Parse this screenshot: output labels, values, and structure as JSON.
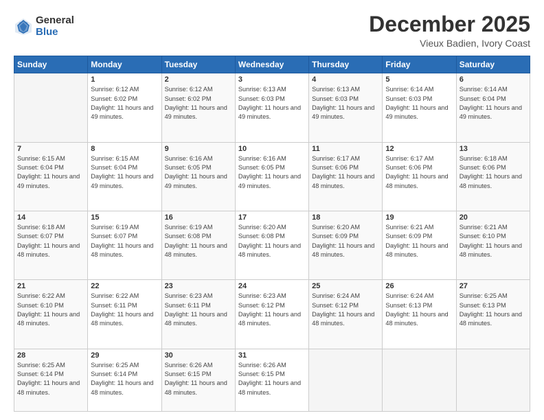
{
  "logo": {
    "general": "General",
    "blue": "Blue"
  },
  "header": {
    "month": "December 2025",
    "location": "Vieux Badien, Ivory Coast"
  },
  "weekdays": [
    "Sunday",
    "Monday",
    "Tuesday",
    "Wednesday",
    "Thursday",
    "Friday",
    "Saturday"
  ],
  "weeks": [
    [
      {
        "day": "",
        "sunrise": "",
        "sunset": "",
        "daylight": ""
      },
      {
        "day": "1",
        "sunrise": "Sunrise: 6:12 AM",
        "sunset": "Sunset: 6:02 PM",
        "daylight": "Daylight: 11 hours and 49 minutes."
      },
      {
        "day": "2",
        "sunrise": "Sunrise: 6:12 AM",
        "sunset": "Sunset: 6:02 PM",
        "daylight": "Daylight: 11 hours and 49 minutes."
      },
      {
        "day": "3",
        "sunrise": "Sunrise: 6:13 AM",
        "sunset": "Sunset: 6:03 PM",
        "daylight": "Daylight: 11 hours and 49 minutes."
      },
      {
        "day": "4",
        "sunrise": "Sunrise: 6:13 AM",
        "sunset": "Sunset: 6:03 PM",
        "daylight": "Daylight: 11 hours and 49 minutes."
      },
      {
        "day": "5",
        "sunrise": "Sunrise: 6:14 AM",
        "sunset": "Sunset: 6:03 PM",
        "daylight": "Daylight: 11 hours and 49 minutes."
      },
      {
        "day": "6",
        "sunrise": "Sunrise: 6:14 AM",
        "sunset": "Sunset: 6:04 PM",
        "daylight": "Daylight: 11 hours and 49 minutes."
      }
    ],
    [
      {
        "day": "7",
        "sunrise": "Sunrise: 6:15 AM",
        "sunset": "Sunset: 6:04 PM",
        "daylight": "Daylight: 11 hours and 49 minutes."
      },
      {
        "day": "8",
        "sunrise": "Sunrise: 6:15 AM",
        "sunset": "Sunset: 6:04 PM",
        "daylight": "Daylight: 11 hours and 49 minutes."
      },
      {
        "day": "9",
        "sunrise": "Sunrise: 6:16 AM",
        "sunset": "Sunset: 6:05 PM",
        "daylight": "Daylight: 11 hours and 49 minutes."
      },
      {
        "day": "10",
        "sunrise": "Sunrise: 6:16 AM",
        "sunset": "Sunset: 6:05 PM",
        "daylight": "Daylight: 11 hours and 49 minutes."
      },
      {
        "day": "11",
        "sunrise": "Sunrise: 6:17 AM",
        "sunset": "Sunset: 6:06 PM",
        "daylight": "Daylight: 11 hours and 48 minutes."
      },
      {
        "day": "12",
        "sunrise": "Sunrise: 6:17 AM",
        "sunset": "Sunset: 6:06 PM",
        "daylight": "Daylight: 11 hours and 48 minutes."
      },
      {
        "day": "13",
        "sunrise": "Sunrise: 6:18 AM",
        "sunset": "Sunset: 6:06 PM",
        "daylight": "Daylight: 11 hours and 48 minutes."
      }
    ],
    [
      {
        "day": "14",
        "sunrise": "Sunrise: 6:18 AM",
        "sunset": "Sunset: 6:07 PM",
        "daylight": "Daylight: 11 hours and 48 minutes."
      },
      {
        "day": "15",
        "sunrise": "Sunrise: 6:19 AM",
        "sunset": "Sunset: 6:07 PM",
        "daylight": "Daylight: 11 hours and 48 minutes."
      },
      {
        "day": "16",
        "sunrise": "Sunrise: 6:19 AM",
        "sunset": "Sunset: 6:08 PM",
        "daylight": "Daylight: 11 hours and 48 minutes."
      },
      {
        "day": "17",
        "sunrise": "Sunrise: 6:20 AM",
        "sunset": "Sunset: 6:08 PM",
        "daylight": "Daylight: 11 hours and 48 minutes."
      },
      {
        "day": "18",
        "sunrise": "Sunrise: 6:20 AM",
        "sunset": "Sunset: 6:09 PM",
        "daylight": "Daylight: 11 hours and 48 minutes."
      },
      {
        "day": "19",
        "sunrise": "Sunrise: 6:21 AM",
        "sunset": "Sunset: 6:09 PM",
        "daylight": "Daylight: 11 hours and 48 minutes."
      },
      {
        "day": "20",
        "sunrise": "Sunrise: 6:21 AM",
        "sunset": "Sunset: 6:10 PM",
        "daylight": "Daylight: 11 hours and 48 minutes."
      }
    ],
    [
      {
        "day": "21",
        "sunrise": "Sunrise: 6:22 AM",
        "sunset": "Sunset: 6:10 PM",
        "daylight": "Daylight: 11 hours and 48 minutes."
      },
      {
        "day": "22",
        "sunrise": "Sunrise: 6:22 AM",
        "sunset": "Sunset: 6:11 PM",
        "daylight": "Daylight: 11 hours and 48 minutes."
      },
      {
        "day": "23",
        "sunrise": "Sunrise: 6:23 AM",
        "sunset": "Sunset: 6:11 PM",
        "daylight": "Daylight: 11 hours and 48 minutes."
      },
      {
        "day": "24",
        "sunrise": "Sunrise: 6:23 AM",
        "sunset": "Sunset: 6:12 PM",
        "daylight": "Daylight: 11 hours and 48 minutes."
      },
      {
        "day": "25",
        "sunrise": "Sunrise: 6:24 AM",
        "sunset": "Sunset: 6:12 PM",
        "daylight": "Daylight: 11 hours and 48 minutes."
      },
      {
        "day": "26",
        "sunrise": "Sunrise: 6:24 AM",
        "sunset": "Sunset: 6:13 PM",
        "daylight": "Daylight: 11 hours and 48 minutes."
      },
      {
        "day": "27",
        "sunrise": "Sunrise: 6:25 AM",
        "sunset": "Sunset: 6:13 PM",
        "daylight": "Daylight: 11 hours and 48 minutes."
      }
    ],
    [
      {
        "day": "28",
        "sunrise": "Sunrise: 6:25 AM",
        "sunset": "Sunset: 6:14 PM",
        "daylight": "Daylight: 11 hours and 48 minutes."
      },
      {
        "day": "29",
        "sunrise": "Sunrise: 6:25 AM",
        "sunset": "Sunset: 6:14 PM",
        "daylight": "Daylight: 11 hours and 48 minutes."
      },
      {
        "day": "30",
        "sunrise": "Sunrise: 6:26 AM",
        "sunset": "Sunset: 6:15 PM",
        "daylight": "Daylight: 11 hours and 48 minutes."
      },
      {
        "day": "31",
        "sunrise": "Sunrise: 6:26 AM",
        "sunset": "Sunset: 6:15 PM",
        "daylight": "Daylight: 11 hours and 48 minutes."
      },
      {
        "day": "",
        "sunrise": "",
        "sunset": "",
        "daylight": ""
      },
      {
        "day": "",
        "sunrise": "",
        "sunset": "",
        "daylight": ""
      },
      {
        "day": "",
        "sunrise": "",
        "sunset": "",
        "daylight": ""
      }
    ]
  ]
}
